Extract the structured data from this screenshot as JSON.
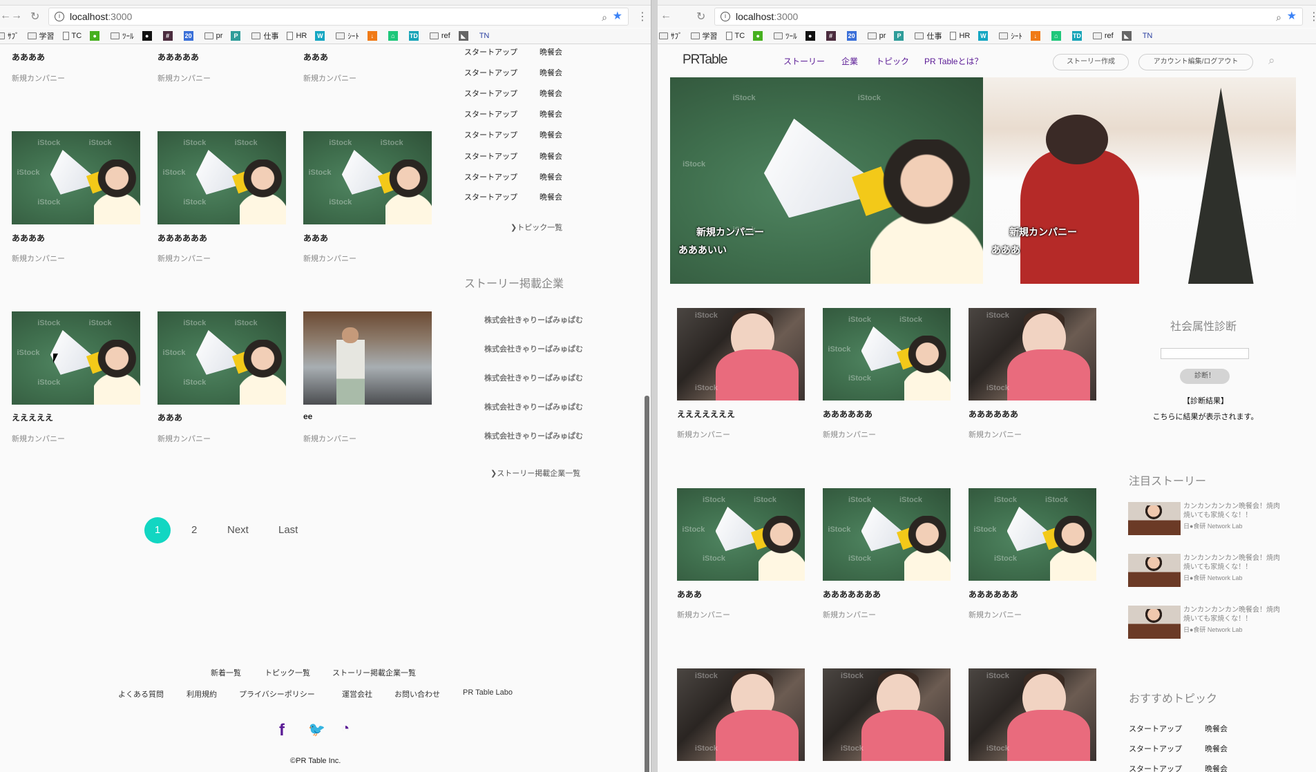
{
  "browser": {
    "url_host": "localhost",
    "url_port": ":3000",
    "bookmarks": [
      {
        "label": "ｻﾌﾞ",
        "icon": "folder-icon"
      },
      {
        "label": "学習",
        "icon": "folder-icon"
      },
      {
        "label": "TC",
        "icon": "page-icon"
      },
      {
        "label": "",
        "icon": "green-app-icon",
        "color": "#46b01f"
      },
      {
        "label": "ﾂｰﾙ",
        "icon": "folder-icon"
      },
      {
        "label": "",
        "icon": "github-icon",
        "color": "#111111"
      },
      {
        "label": "",
        "icon": "hash-icon",
        "color": "#4a2b3d"
      },
      {
        "label": "",
        "icon": "calendar-icon",
        "color": "#3a6fd8"
      },
      {
        "label": "pr",
        "icon": "folder-icon"
      },
      {
        "label": "",
        "icon": "p-app-icon",
        "color": "#2f9d9a"
      },
      {
        "label": "仕事",
        "icon": "folder-icon"
      },
      {
        "label": "HR",
        "icon": "page-icon"
      },
      {
        "label": "",
        "icon": "w-app-icon",
        "color": "#14a6c2"
      },
      {
        "label": "ｼｰﾄ",
        "icon": "folder-icon"
      },
      {
        "label": "",
        "icon": "download-icon",
        "color": "#f07a17"
      },
      {
        "label": "",
        "icon": "house-app-icon",
        "color": "#1fc77a"
      },
      {
        "label": "",
        "icon": "td-app-icon",
        "color": "#17a4b8"
      },
      {
        "label": "ref",
        "icon": "folder-icon"
      },
      {
        "label": "",
        "icon": "bird-icon",
        "color": "#666666"
      },
      {
        "label": "TN",
        "icon": "tn-icon"
      }
    ],
    "bookmark_glyphs": {
      "calendar-icon": "20",
      "hash-icon": "#",
      "p-app-icon": "P",
      "w-app-icon": "W",
      "td-app-icon": "TD",
      "download-icon": "↓",
      "green-app-icon": "●",
      "github-icon": "●",
      "house-app-icon": "⌂",
      "bird-icon": "◣"
    }
  },
  "left": {
    "cards": [
      {
        "title": "ああああ",
        "company": "新規カンパニー",
        "image": "none"
      },
      {
        "title": "あああああ",
        "company": "新規カンパニー",
        "image": "none"
      },
      {
        "title": "あああ",
        "company": "新規カンパニー",
        "image": "none"
      },
      {
        "title": "ああああ",
        "company": "新規カンパニー",
        "image": "megaphone"
      },
      {
        "title": "ああああああ",
        "company": "新規カンパニー",
        "image": "megaphone"
      },
      {
        "title": "あああ",
        "company": "新規カンパニー",
        "image": "megaphone"
      },
      {
        "title": "えええええ",
        "company": "新規カンパニー",
        "image": "megaphone"
      },
      {
        "title": "あああ",
        "company": "新規カンパニー",
        "image": "megaphone"
      },
      {
        "title": "ee",
        "company": "新規カンパニー",
        "image": "factory"
      }
    ],
    "topics": [
      [
        "スタートアップ",
        "晩餐会"
      ],
      [
        "スタートアップ",
        "晩餐会"
      ],
      [
        "スタートアップ",
        "晩餐会"
      ],
      [
        "スタートアップ",
        "晩餐会"
      ],
      [
        "スタートアップ",
        "晩餐会"
      ],
      [
        "スタートアップ",
        "晩餐会"
      ],
      [
        "スタートアップ",
        "晩餐会"
      ],
      [
        "スタートアップ",
        "晩餐会"
      ]
    ],
    "topics_more": "❯トピック一覧",
    "companies_heading": "ストーリー掲載企業",
    "companies": [
      "株式会社きゃりーぱみゅぱむ",
      "株式会社きゃりーぱみゅぱむ",
      "株式会社きゃりーぱみゅぱむ",
      "株式会社きゃりーぱみゅぱむ",
      "株式会社きゃりーぱみゅぱむ"
    ],
    "companies_more": "❯ストーリー掲載企業一覧",
    "pagination": {
      "current": "1",
      "next_page": "2",
      "next": "Next",
      "last": "Last"
    },
    "footer": {
      "row1": [
        "新着一覧",
        "トピック一覧",
        "ストーリー掲載企業一覧"
      ],
      "row2": [
        "よくある質問",
        "利用規約",
        "プライバシーポリシー",
        "運営会社",
        "お問い合わせ",
        "PR Table Labo"
      ],
      "social": [
        {
          "icon": "facebook-icon",
          "glyph": "f"
        },
        {
          "icon": "twitter-icon",
          "glyph": "🐦"
        },
        {
          "icon": "rss-icon",
          "glyph": "◔"
        }
      ],
      "copyright": "©PR Table Inc."
    }
  },
  "right": {
    "logo": "PRTable",
    "nav": [
      "ストーリー",
      "企業",
      "トピック",
      "PR Tableとは？"
    ],
    "create_story": "ストーリー作成",
    "account": "アカウント編集/ログアウト",
    "hero": [
      {
        "company": "新規カンパニー",
        "title": "あああいい",
        "image": "megaphone"
      },
      {
        "company": "新規カンパニー",
        "title": "あああ",
        "image": "santa"
      }
    ],
    "cards": [
      {
        "title": "えええええええ",
        "company": "新規カンパニー",
        "image": "baby"
      },
      {
        "title": "ああああああ",
        "company": "新規カンパニー",
        "image": "megaphone"
      },
      {
        "title": "ああああああ",
        "company": "新規カンパニー",
        "image": "baby"
      },
      {
        "title": "あああ",
        "company": "新規カンパニー",
        "image": "megaphone"
      },
      {
        "title": "あああああああ",
        "company": "新規カンパニー",
        "image": "megaphone"
      },
      {
        "title": "ああああああ",
        "company": "新規カンパニー",
        "image": "megaphone"
      },
      {
        "title": "",
        "company": "",
        "image": "baby"
      },
      {
        "title": "",
        "company": "",
        "image": "baby"
      },
      {
        "title": "",
        "company": "",
        "image": "baby"
      }
    ],
    "diagnosis": {
      "heading": "社会属性診断",
      "input_value": "",
      "button": "診断！",
      "result_label": "【診断結果】",
      "result_text": "こちらに結果が表示されます。"
    },
    "featured_heading": "注目ストーリー",
    "featured": [
      {
        "title": "カンカンカンカン晩餐会！焼肉焼いても家焼くな！！",
        "source": "日●食研 Network Lab"
      },
      {
        "title": "カンカンカンカン晩餐会！焼肉焼いても家焼くな！！",
        "source": "日●食研 Network Lab"
      },
      {
        "title": "カンカンカンカン晩餐会！焼肉焼いても家焼くな！！",
        "source": "日●食研 Network Lab"
      }
    ],
    "recommended_heading": "おすすめトピック",
    "recommended": [
      [
        "スタートアップ",
        "晩餐会"
      ],
      [
        "スタートアップ",
        "晩餐会"
      ],
      [
        "スタートアップ",
        "晩餐会"
      ]
    ]
  }
}
